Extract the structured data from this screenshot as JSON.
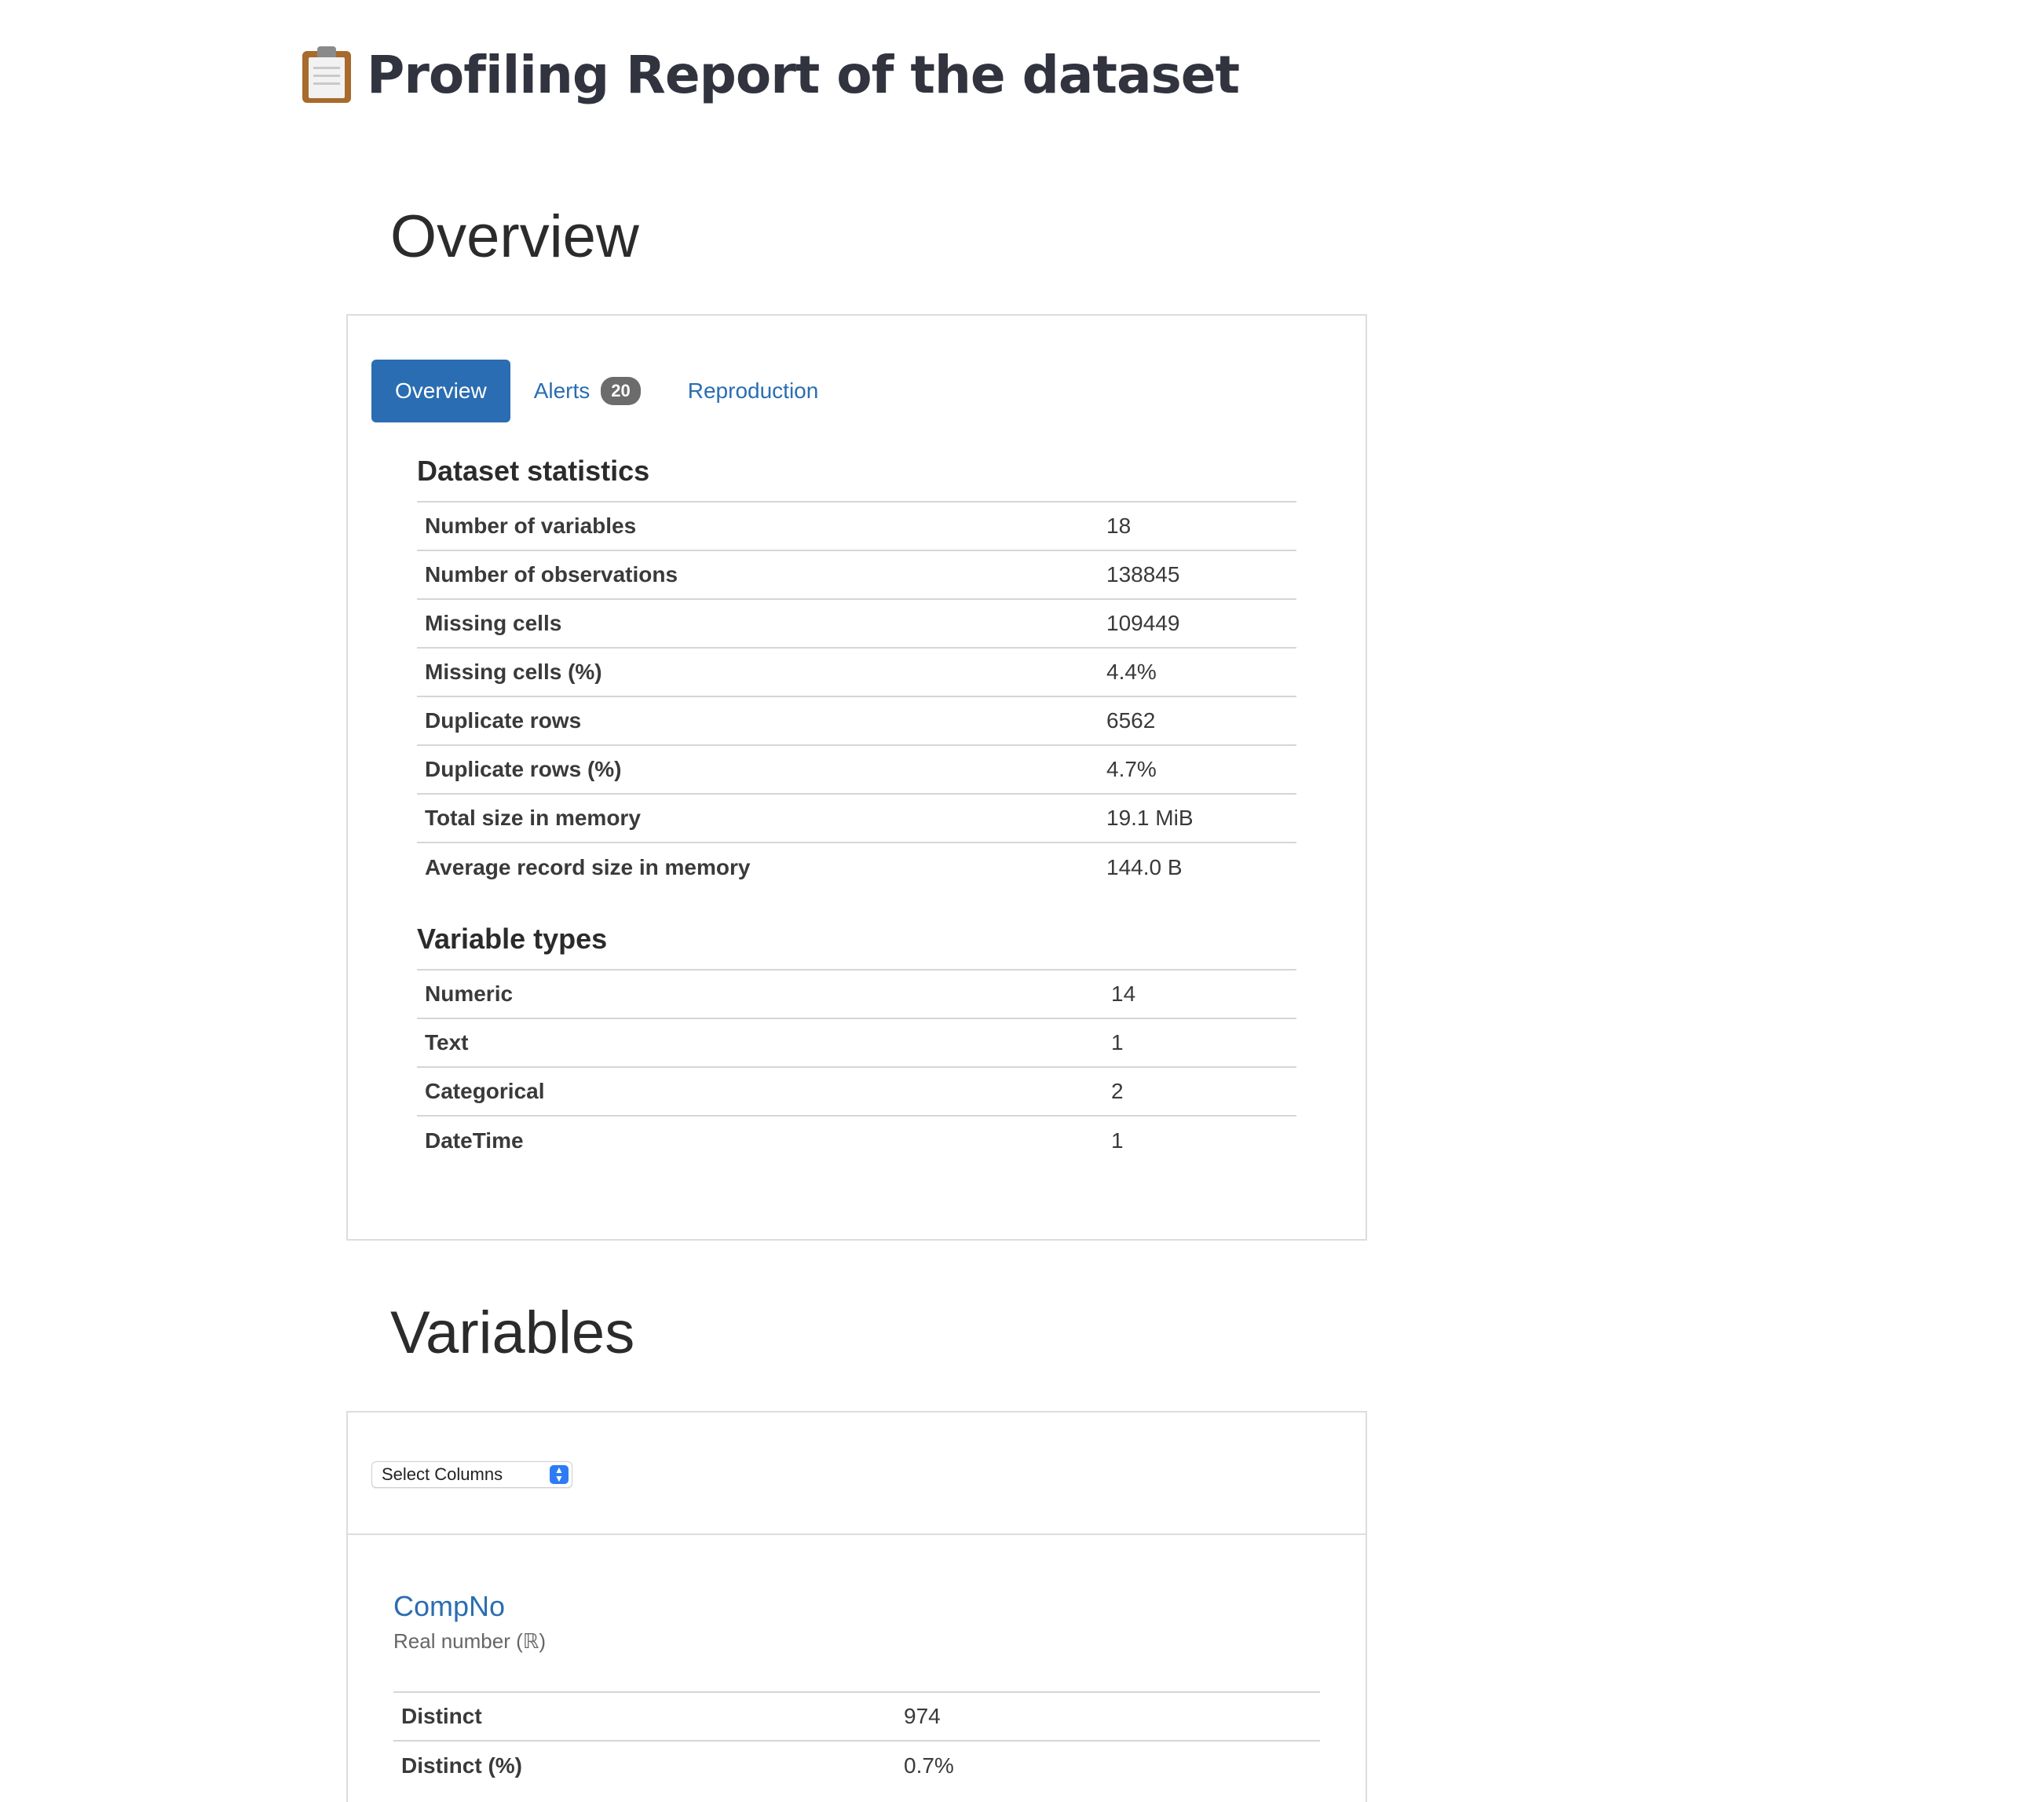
{
  "page": {
    "title": "Profiling Report of the dataset",
    "title_icon": "clipboard-icon"
  },
  "overview": {
    "heading": "Overview",
    "tabs": [
      {
        "label": "Overview",
        "active": true
      },
      {
        "label": "Alerts",
        "badge": "20",
        "active": false
      },
      {
        "label": "Reproduction",
        "active": false
      }
    ],
    "dataset_statistics": {
      "heading": "Dataset statistics",
      "rows": [
        {
          "label": "Number of variables",
          "value": "18"
        },
        {
          "label": "Number of observations",
          "value": "138845"
        },
        {
          "label": "Missing cells",
          "value": "109449"
        },
        {
          "label": "Missing cells (%)",
          "value": "4.4%"
        },
        {
          "label": "Duplicate rows",
          "value": "6562"
        },
        {
          "label": "Duplicate rows (%)",
          "value": "4.7%"
        },
        {
          "label": "Total size in memory",
          "value": "19.1 MiB"
        },
        {
          "label": "Average record size in memory",
          "value": "144.0 B"
        }
      ]
    },
    "variable_types": {
      "heading": "Variable types",
      "rows": [
        {
          "label": "Numeric",
          "value": "14"
        },
        {
          "label": "Text",
          "value": "1"
        },
        {
          "label": "Categorical",
          "value": "2"
        },
        {
          "label": "DateTime",
          "value": "1"
        }
      ]
    }
  },
  "variables": {
    "heading": "Variables",
    "select": {
      "value": "Select Columns"
    },
    "items": [
      {
        "name": "CompNo",
        "type": "Real number (ℝ)",
        "stats": [
          {
            "label": "Distinct",
            "value": "974"
          },
          {
            "label": "Distinct (%)",
            "value": "0.7%"
          }
        ]
      }
    ]
  },
  "colors": {
    "accent": "#2a6db2",
    "badge": "#6c6c6c",
    "title": "#31333f",
    "select_control": "#2d7cf6"
  }
}
